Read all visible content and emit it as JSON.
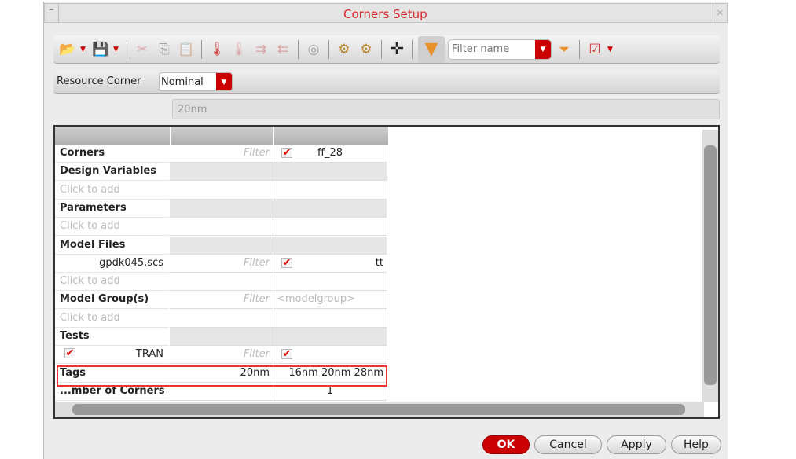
{
  "window": {
    "title": "Corners Setup"
  },
  "toolbar": {
    "filter_placeholder": "Filter name",
    "icons": [
      "open-csv-icon",
      "save-csv-icon",
      "cut-icon",
      "copy-icon",
      "paste-icon",
      "add-corner-icon",
      "delete-corner-icon",
      "move-right-icon",
      "move-left-icon",
      "disabled-icon",
      "settings-icon",
      "settings-copy-icon",
      "move-icon",
      "filter-icon",
      "clear-filter-icon",
      "view-options-icon"
    ]
  },
  "resource_corner": {
    "label": "Resource Corner",
    "value": "Nominal"
  },
  "tag_field": {
    "value": "20nm"
  },
  "table": {
    "rows": [
      {
        "label": "Corners",
        "bold": true,
        "c1": "Filter",
        "c1_filter": true,
        "c2": "ff_28",
        "c2_check": true,
        "c2_align": "center"
      },
      {
        "label": "Design Variables",
        "bold": true,
        "grey": true
      },
      {
        "label": "Click to add",
        "placeholder": true
      },
      {
        "label": "Parameters",
        "bold": true,
        "grey": true
      },
      {
        "label": "Click to add",
        "placeholder": true
      },
      {
        "label": "Model Files",
        "bold": true,
        "grey": true
      },
      {
        "label": "gpdk045.scs",
        "right": true,
        "c1": "Filter",
        "c1_filter": true,
        "c2": "tt",
        "c2_check": true,
        "c2_align": "right"
      },
      {
        "label": "Click to add",
        "placeholder": true
      },
      {
        "label": "Model Group(s)",
        "bold": true,
        "c1": "Filter",
        "c1_filter": true,
        "c2": "<modelgroup>",
        "c2_ph": true
      },
      {
        "label": "Click to add",
        "placeholder": true
      },
      {
        "label": "Tests",
        "bold": true,
        "grey": true
      },
      {
        "label": "TRAN",
        "right": true,
        "label_check": true,
        "c1": "Filter",
        "c1_filter": true,
        "c2": "",
        "c2_check": true
      },
      {
        "label": "Tags",
        "bold": true,
        "c1": "20nm",
        "c2": "16nm 20nm 28nm",
        "c2_align": "right"
      },
      {
        "label": "...mber of Corners",
        "bold": true,
        "c2": "1",
        "c2_align": "center"
      }
    ]
  },
  "buttons": {
    "ok": "OK",
    "cancel": "Cancel",
    "apply": "Apply",
    "help": "Help"
  },
  "colors": {
    "accent": "#cc0000",
    "title": "#d8262b",
    "highlight": "#ee3333"
  }
}
